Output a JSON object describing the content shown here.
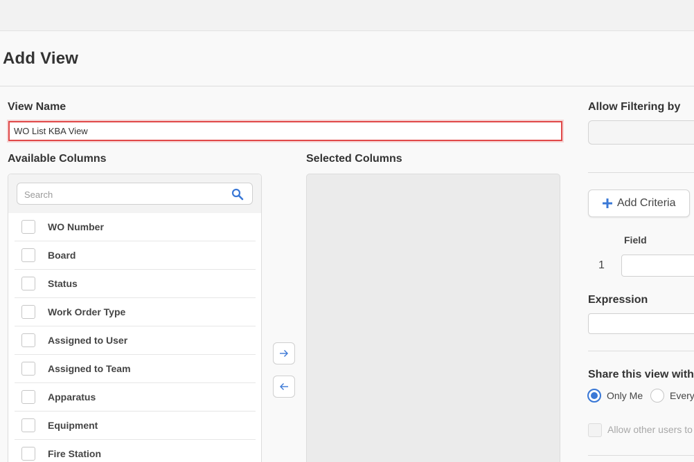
{
  "page": {
    "title": "Add View"
  },
  "view_name": {
    "label": "View Name",
    "value": "WO List KBA View"
  },
  "available_columns": {
    "label": "Available Columns",
    "search_placeholder": "Search",
    "items": [
      {
        "label": "WO Number"
      },
      {
        "label": "Board"
      },
      {
        "label": "Status"
      },
      {
        "label": "Work Order Type"
      },
      {
        "label": "Assigned to User"
      },
      {
        "label": "Assigned to Team"
      },
      {
        "label": "Apparatus"
      },
      {
        "label": "Equipment"
      },
      {
        "label": "Fire Station"
      }
    ]
  },
  "selected_columns": {
    "label": "Selected Columns"
  },
  "filtering": {
    "label": "Allow Filtering by",
    "add_criteria_label": "Add Criteria",
    "field_header": "Field",
    "row_number": "1",
    "expression_label": "Expression"
  },
  "share": {
    "label": "Share this view with",
    "options": [
      {
        "label": "Only Me",
        "selected": true
      },
      {
        "label": "Every",
        "selected": false
      }
    ],
    "allow_others_label": "Allow other users to"
  },
  "colors": {
    "accent": "#3a78d6",
    "highlight_border": "#e04848"
  }
}
